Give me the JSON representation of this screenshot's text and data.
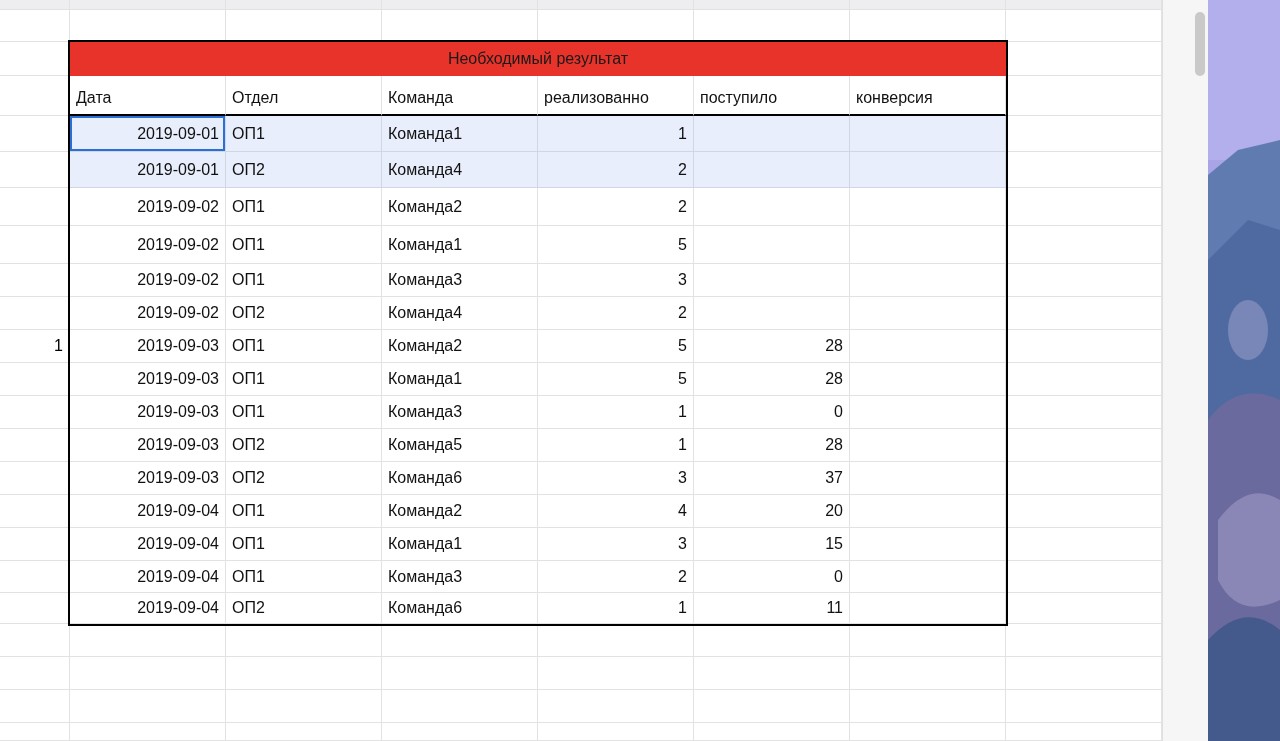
{
  "table": {
    "title": "Необходимый результат",
    "columns": [
      "Дата",
      "Отдел",
      "Команда",
      "реализованно",
      "поступило",
      "конверсия"
    ],
    "rows": [
      {
        "cells": [
          "2019-09-01",
          "ОП1",
          "Команда1",
          "1",
          "",
          ""
        ],
        "selected": true,
        "active": true
      },
      {
        "cells": [
          "2019-09-01",
          "ОП2",
          "Команда4",
          "2",
          "",
          ""
        ],
        "selected": true,
        "active": false
      },
      {
        "cells": [
          "2019-09-02",
          "ОП1",
          "Команда2",
          "2",
          "",
          ""
        ],
        "selected": false,
        "active": false
      },
      {
        "cells": [
          "2019-09-02",
          "ОП1",
          "Команда1",
          "5",
          "",
          ""
        ],
        "selected": false,
        "active": false
      },
      {
        "cells": [
          "2019-09-02",
          "ОП1",
          "Команда3",
          "3",
          "",
          ""
        ],
        "selected": false,
        "active": false
      },
      {
        "cells": [
          "2019-09-02",
          "ОП2",
          "Команда4",
          "2",
          "",
          ""
        ],
        "selected": false,
        "active": false
      },
      {
        "cells": [
          "2019-09-03",
          "ОП1",
          "Команда2",
          "5",
          "28",
          ""
        ],
        "selected": false,
        "active": false,
        "side": "1"
      },
      {
        "cells": [
          "2019-09-03",
          "ОП1",
          "Команда1",
          "5",
          "28",
          ""
        ],
        "selected": false,
        "active": false
      },
      {
        "cells": [
          "2019-09-03",
          "ОП1",
          "Команда3",
          "1",
          "0",
          ""
        ],
        "selected": false,
        "active": false
      },
      {
        "cells": [
          "2019-09-03",
          "ОП2",
          "Команда5",
          "1",
          "28",
          ""
        ],
        "selected": false,
        "active": false
      },
      {
        "cells": [
          "2019-09-03",
          "ОП2",
          "Команда6",
          "3",
          "37",
          ""
        ],
        "selected": false,
        "active": false
      },
      {
        "cells": [
          "2019-09-04",
          "ОП1",
          "Команда2",
          "4",
          "20",
          ""
        ],
        "selected": false,
        "active": false
      },
      {
        "cells": [
          "2019-09-04",
          "ОП1",
          "Команда1",
          "3",
          "15",
          ""
        ],
        "selected": false,
        "active": false
      },
      {
        "cells": [
          "2019-09-04",
          "ОП1",
          "Команда3",
          "2",
          "0",
          ""
        ],
        "selected": false,
        "active": false
      },
      {
        "cells": [
          "2019-09-04",
          "ОП2",
          "Команда6",
          "1",
          "11",
          ""
        ],
        "selected": false,
        "active": false
      }
    ]
  }
}
